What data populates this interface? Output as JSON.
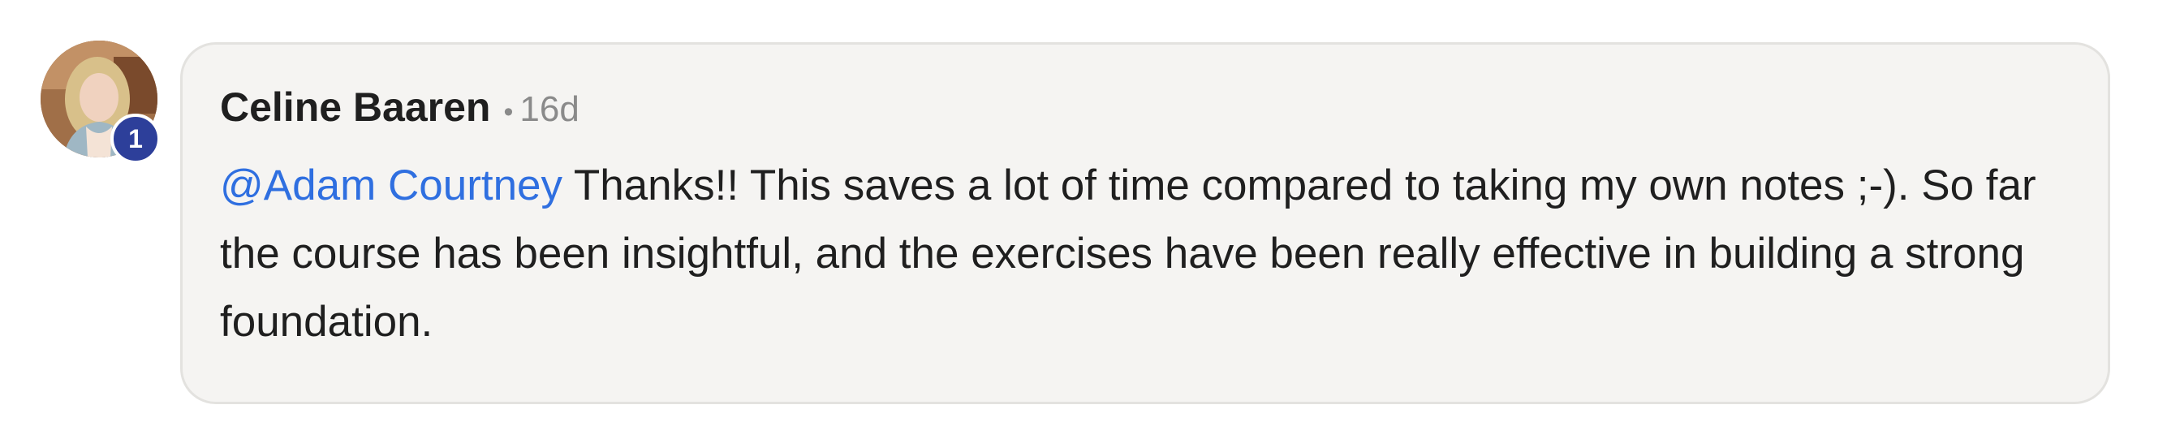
{
  "comment": {
    "author": "Celine Baaren",
    "separator": "•",
    "timestamp": "16d",
    "level_badge": "1",
    "mention": "@Adam Courtney",
    "text": "Thanks!! This saves a lot of time compared to taking my own notes ;-). So far the course has been insightful, and the exercises have been really effective in building a strong foundation."
  },
  "colors": {
    "mention": "#2f6fe0",
    "badge": "#2d3f9a",
    "bubble_bg": "#f5f4f2"
  }
}
